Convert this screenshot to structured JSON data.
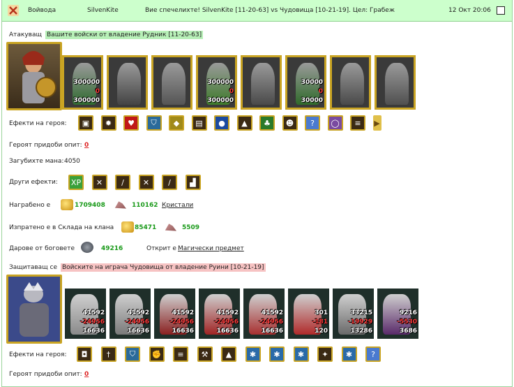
{
  "header": {
    "type": "Войвода",
    "player": "SilvenKite",
    "message": "Вие спечелихте! SilvenKite [11-20-63] vs Чудовища [10-21-19]. Цел: Грабеж",
    "date": "12 Окт 20:06"
  },
  "attacker": {
    "label": "Атакуващ",
    "desc": "Вашите войски от владение Рудник [11-20-63]",
    "units": [
      {
        "top": "300000",
        "mid": "0",
        "bot": "300000"
      },
      {
        "top": "",
        "mid": "",
        "bot": ""
      },
      {
        "top": "",
        "mid": "",
        "bot": ""
      },
      {
        "top": "300000",
        "mid": "0",
        "bot": "300000"
      },
      {
        "top": "",
        "mid": "",
        "bot": ""
      },
      {
        "top": "30000",
        "mid": "0",
        "bot": "30000"
      },
      {
        "top": "",
        "mid": "",
        "bot": ""
      },
      {
        "top": "",
        "mid": "",
        "bot": ""
      }
    ],
    "effects_label": "Ефекти на героя:",
    "xp_label": "Героят придоби опит:",
    "xp_value": "0",
    "mana_label": "Загубихте мана:",
    "mana_value": "4050",
    "other_label": "Други ефекти:",
    "reward_label": "Награбено е",
    "reward_gold": "1709408",
    "reward_crystal": "110162",
    "reward_link": "Кристали",
    "spent_label": "Изпратено е в Склада на клана",
    "spent_gold": "85471",
    "spent_crystal": "5509",
    "gift_label": "Дарове от боговете",
    "gift_value": "49216",
    "found_label": "Открит е",
    "found_link": "Магически предмет"
  },
  "defender": {
    "label": "Защитаващ се",
    "desc": "Войските на играча Чудовища от владение Руини [10-21-19]",
    "units": [
      {
        "n1": "41592",
        "n2": "-24956",
        "n3": "16636"
      },
      {
        "n1": "41592",
        "n2": "-24956",
        "n3": "16636"
      },
      {
        "n1": "41592",
        "n2": "-24956",
        "n3": "16636"
      },
      {
        "n1": "41592",
        "n2": "-24956",
        "n3": "16636"
      },
      {
        "n1": "41592",
        "n2": "-24956",
        "n3": "16636"
      },
      {
        "n1": "301",
        "n2": "-181",
        "n3": "120"
      },
      {
        "n1": "33215",
        "n2": "-19929",
        "n3": "13286"
      },
      {
        "n1": "9216",
        "n2": "-5530",
        "n3": "3686"
      }
    ],
    "effects_label": "Ефекти на героя:",
    "xp_label": "Героят придоби опит:",
    "xp_value": "0"
  },
  "effect_icons": {
    "attacker": [
      "chest-icon",
      "fire-icon",
      "heart-icon",
      "shield-icon",
      "gem-icon",
      "armor-icon",
      "potion-icon",
      "helmet-icon",
      "tree-icon",
      "mask-icon",
      "question-icon",
      "ring-icon",
      "scroll-icon",
      "arrow-right-icon"
    ],
    "other": [
      "xp-icon",
      "sword-icon",
      "blade-icon",
      "sword-icon",
      "blade-icon",
      "boot-icon"
    ],
    "defender": [
      "bag-icon",
      "dagger-icon",
      "shield-icon",
      "fist-icon",
      "scroll-icon",
      "hammer-icon",
      "helmet-icon",
      "ice-icon",
      "ice-icon",
      "ice-icon",
      "mace-icon",
      "ice-icon",
      "question-icon"
    ]
  }
}
